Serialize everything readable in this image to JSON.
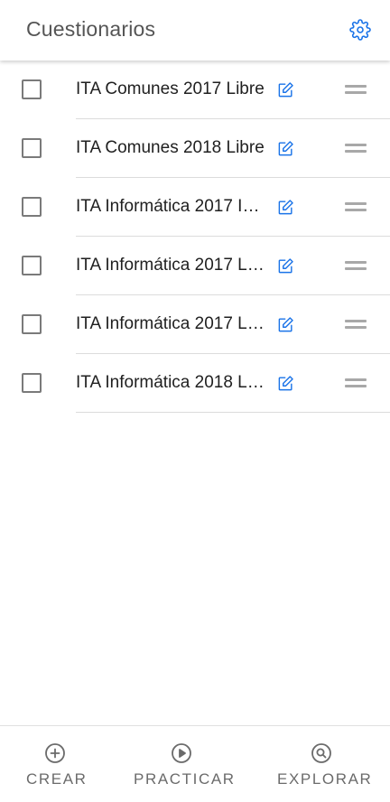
{
  "header": {
    "title": "Cuestionarios",
    "settings_icon": "gear-icon"
  },
  "colors": {
    "accent": "#1a73e8",
    "text": "#1f1f1f",
    "muted": "#6b6b6b",
    "divider": "#dcdcdc"
  },
  "list": {
    "items": [
      {
        "label": "ITA Comunes 2017 Libre",
        "checked": false
      },
      {
        "label": "ITA Comunes 2018 Libre",
        "checked": false
      },
      {
        "label": "ITA Informática 2017 I…",
        "checked": false
      },
      {
        "label": "ITA Informática 2017 L…",
        "checked": false
      },
      {
        "label": "ITA Informática 2017 L…",
        "checked": false
      },
      {
        "label": "ITA Informática 2018 L…",
        "checked": false
      }
    ]
  },
  "bottom_nav": {
    "items": [
      {
        "label": "CREAR",
        "icon": "plus-circle-icon"
      },
      {
        "label": "PRACTICAR",
        "icon": "play-circle-icon"
      },
      {
        "label": "EXPLORAR",
        "icon": "search-circle-icon"
      }
    ]
  }
}
